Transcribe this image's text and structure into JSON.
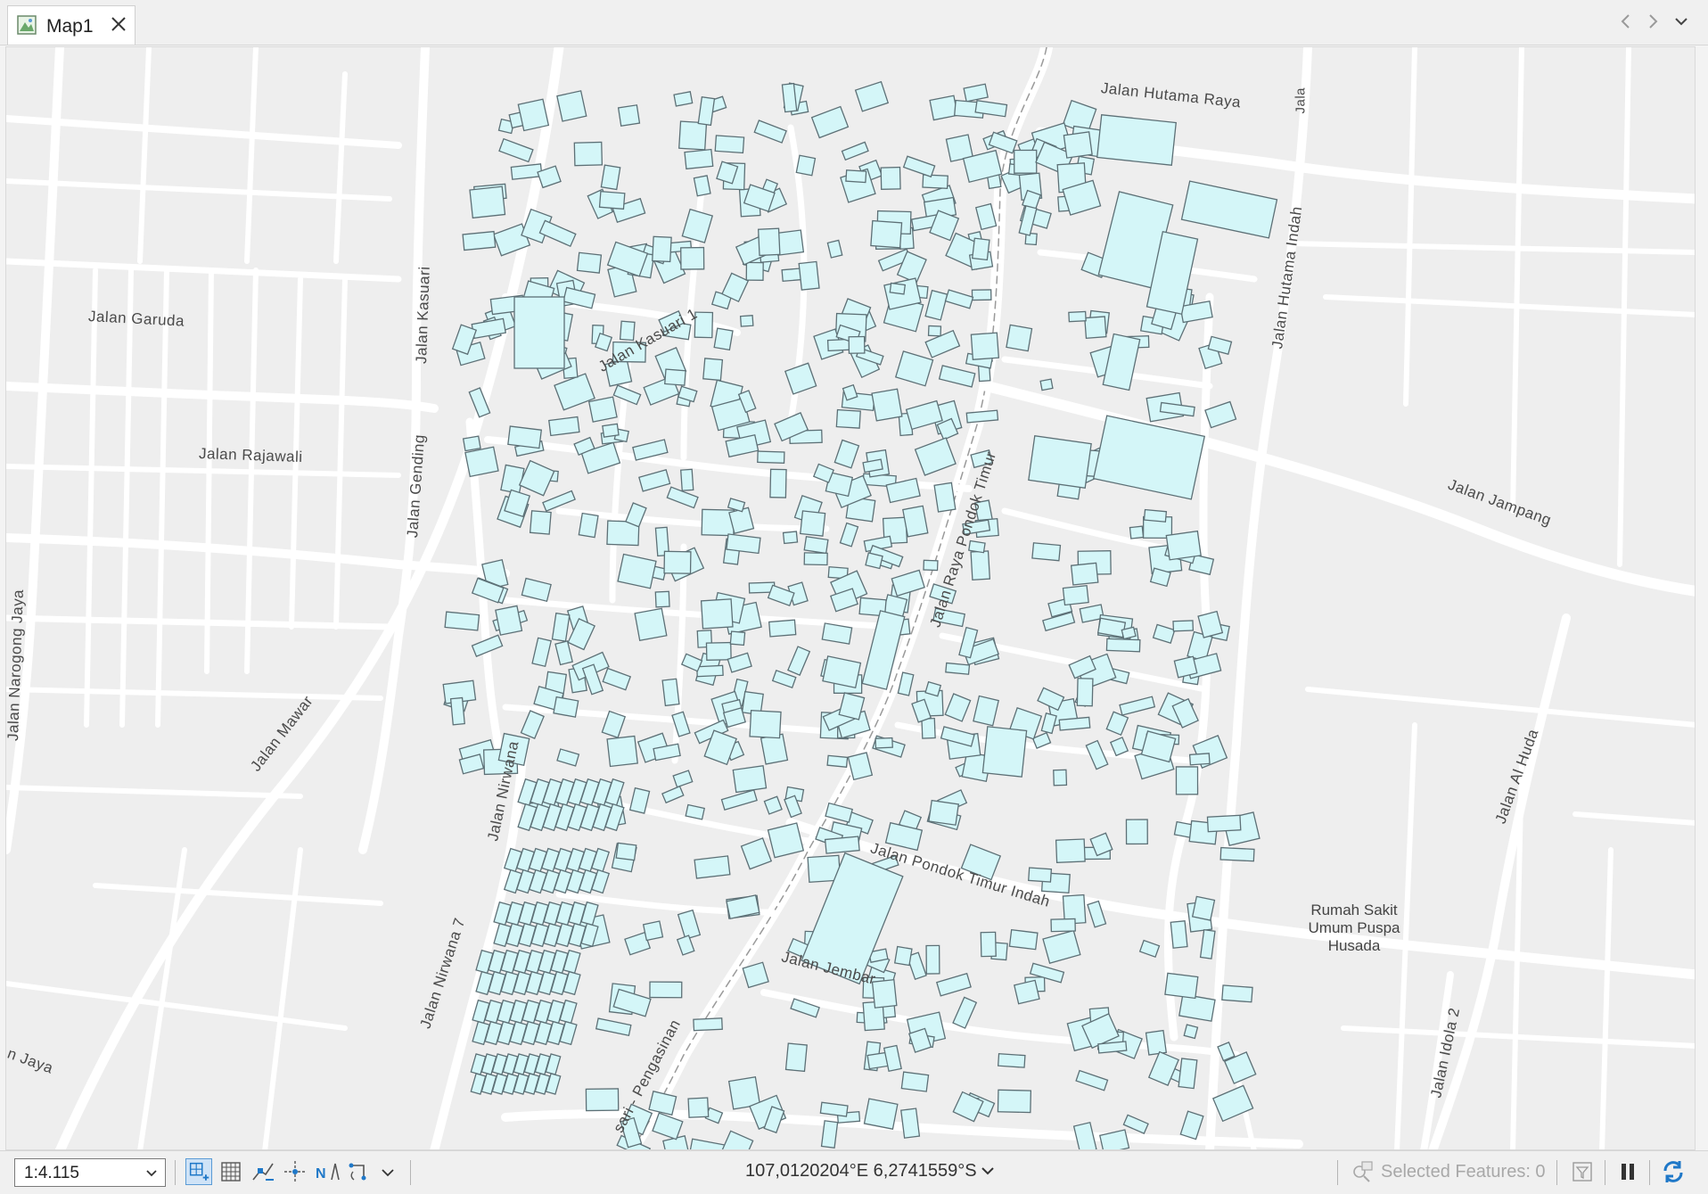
{
  "tab": {
    "title": "Map1"
  },
  "colors": {
    "map_background": "#eeeeee",
    "road": "#ffffff",
    "building_fill": "#d4f6f8",
    "building_stroke": "#5d7076",
    "label_text": "#4a4a4a",
    "accent": "#1f78c8"
  },
  "map": {
    "street_labels": [
      "Jalan Hutama Raya",
      "Jala",
      "Jalan Hutama Indah",
      "Jalan Kasuari",
      "Jalan Kasuari 1",
      "Jalan Garuda",
      "Jalan Gending",
      "Jalan Raya Pondok Timur",
      "Jalan Jampang",
      "Jalan Rajawali",
      "Jalan Narogong Jaya",
      "Jalan Mawar",
      "Jalan Nirwana",
      "Jalan Pondok Timur Indah",
      "Jalan Al Huda",
      "Jalan Nirwana 7",
      "Jalan Jembar",
      "n Jaya",
      "sari - Pengasinan",
      "Jalan Idola 2"
    ],
    "poi_label": "Rumah Sakit Umum Puspa Husada"
  },
  "statusbar": {
    "scale": "1:4.115",
    "coordinates": "107,0120204°E 6,2741559°S",
    "selected_features": "Selected Features: 0"
  },
  "icons": {
    "tab": "map-icon",
    "close": "close-icon",
    "nav_back": "chevron-left-icon",
    "nav_forward": "chevron-right-icon",
    "nav_menu": "chevron-down-icon",
    "basemap": "basemap-layers-icon",
    "tools": [
      "fixed-zoom-icon",
      "grid-icon",
      "snapping-icon",
      "constraint-icon",
      "north-arrow-icon",
      "rotate-icon",
      "more-tools-icon"
    ],
    "selected": "selected-features-icon",
    "filter": "filter-icon",
    "pause": "pause-icon",
    "refresh": "refresh-icon"
  }
}
